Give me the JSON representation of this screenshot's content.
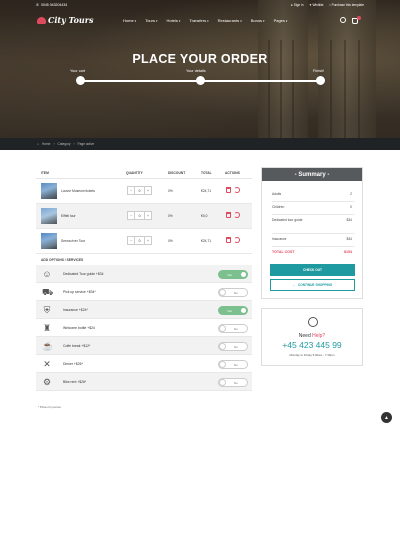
{
  "topbar": {
    "phone": "0045 043204434",
    "sign_in": "Sign in",
    "wishlist": "Wishlist",
    "purchase": "Purchase this template"
  },
  "nav": {
    "brand": "City Tours",
    "menu": [
      "Home",
      "Tours",
      "Hotels",
      "Transfers",
      "Restaurants",
      "Bonus",
      "Pages"
    ]
  },
  "hero": {
    "title": "PLACE YOUR ORDER",
    "steps": [
      "Your cart",
      "Your details",
      "Finish!"
    ]
  },
  "breadcrumb": [
    "Home",
    "Category",
    "Page active"
  ],
  "cart": {
    "headers": {
      "item": "ITEM",
      "quantity": "QUANTITY",
      "discount": "DISCOUNT",
      "total": "TOTAL",
      "actions": "ACTIONS"
    },
    "rows": [
      {
        "name": "Louvre Museum tickets",
        "qty": "0",
        "discount": "0%",
        "total": "€24,71"
      },
      {
        "name": "Eiffell tour",
        "qty": "0",
        "discount": "0%",
        "total": "€0,0"
      },
      {
        "name": "Senna river Tour",
        "qty": "0",
        "discount": "0%",
        "total": "€24,71"
      }
    ],
    "minus": "−",
    "plus": "+"
  },
  "addons": {
    "heading": "ADD OPTIONS / SERVICES",
    "items": [
      {
        "label": "Dedicated Tour guide +$34",
        "state": "Yes",
        "on": true,
        "icon": "guide-icon"
      },
      {
        "label": "Pick up service +$34*",
        "state": "No",
        "on": false,
        "icon": "car-icon"
      },
      {
        "label": "Insurance +$24*",
        "state": "Yes",
        "on": true,
        "icon": "insurance-icon"
      },
      {
        "label": "Welcome bottle +$24",
        "state": "No",
        "on": false,
        "icon": "bottle-icon"
      },
      {
        "label": "Coffe break +$12*",
        "state": "No",
        "on": false,
        "icon": "coffee-icon"
      },
      {
        "label": "Dinner +$26*",
        "state": "No",
        "on": false,
        "icon": "dinner-icon"
      },
      {
        "label": "Bike rent +$26*",
        "state": "No",
        "on": false,
        "icon": "bike-icon"
      }
    ],
    "note": "* Prices for person."
  },
  "summary": {
    "title": "- Summary -",
    "rows": [
      {
        "label": "Adults",
        "value": "2"
      },
      {
        "label": "Children",
        "value": "0"
      },
      {
        "label": "Dedicated tour guide",
        "value": "$34"
      },
      {
        "label": "Insurance",
        "value": "$34"
      }
    ],
    "total_label": "TOTAL COST",
    "total_value": "$154",
    "checkout": "CHECK OUT",
    "continue": "CONTINUE SHOPPING"
  },
  "help": {
    "need": "Need",
    "help": "Help?",
    "phone": "+45 423 445 99",
    "hours": "Monday to Friday 9.00am - 7.30pm"
  },
  "colors": {
    "accent": "#1f9aa0",
    "brand": "#e04a5f",
    "toggle_on": "#7cc08f"
  }
}
